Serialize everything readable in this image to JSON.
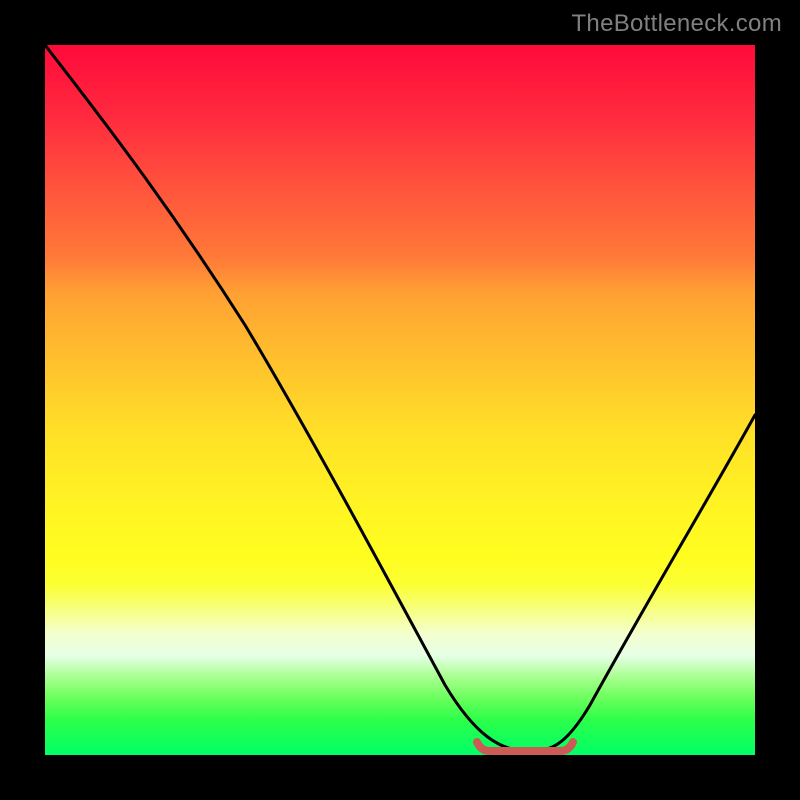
{
  "watermark": "TheBottleneck.com",
  "chart_data": {
    "type": "line",
    "title": "",
    "xlabel": "",
    "ylabel": "",
    "xlim": [
      0,
      100
    ],
    "ylim": [
      0,
      100
    ],
    "series": [
      {
        "name": "curve",
        "x": [
          0,
          10,
          20,
          30,
          40,
          50,
          55,
          60,
          64,
          68,
          72,
          80,
          90,
          100
        ],
        "values": [
          100,
          88,
          75,
          60,
          44,
          27,
          18,
          10,
          2,
          0,
          0,
          10,
          28,
          48
        ]
      }
    ],
    "highlight": {
      "name": "optimal-range",
      "x_start": 60,
      "x_end": 74,
      "y": 0,
      "color": "#cc5b56"
    },
    "gradient_stops": [
      {
        "pos": 0,
        "color": "#ff0a3a"
      },
      {
        "pos": 50,
        "color": "#ffe127"
      },
      {
        "pos": 80,
        "color": "#f3ffcf"
      },
      {
        "pos": 100,
        "color": "#00ff66"
      }
    ]
  }
}
